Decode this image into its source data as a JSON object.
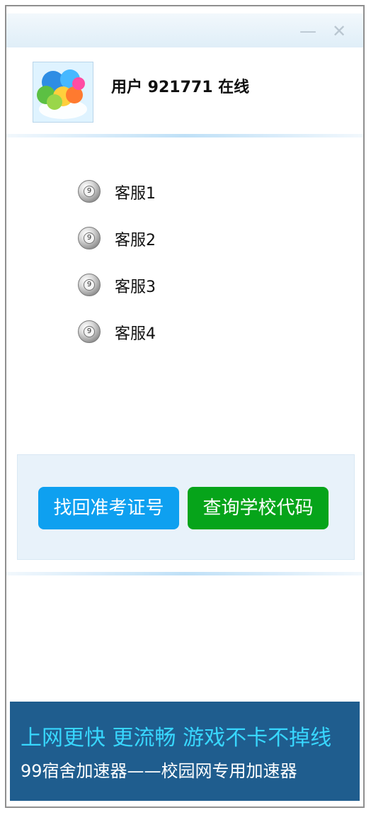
{
  "window": {
    "minimize_label": "—",
    "close_label": "✕"
  },
  "header": {
    "title": "用户 921771 在线",
    "avatar_icon": "balloon-avatar-icon"
  },
  "service": {
    "items": [
      {
        "label": "客服1",
        "icon": "qq-icon",
        "icon_text": "9"
      },
      {
        "label": "客服2",
        "icon": "qq-icon",
        "icon_text": "9"
      },
      {
        "label": "客服3",
        "icon": "qq-icon",
        "icon_text": "9"
      },
      {
        "label": "客服4",
        "icon": "qq-icon",
        "icon_text": "9"
      }
    ]
  },
  "actions": {
    "retrieve_label": "找回准考证号",
    "query_label": "查询学校代码"
  },
  "banner": {
    "line1": "上网更快  更流畅   游戏不卡不掉线",
    "line2": "99宿舍加速器——校园网专用加速器"
  },
  "colors": {
    "blue_button": "#0ea0f0",
    "green_button": "#06a41a",
    "banner_bg": "#1f5d8e",
    "banner_accent": "#38d7ff"
  }
}
